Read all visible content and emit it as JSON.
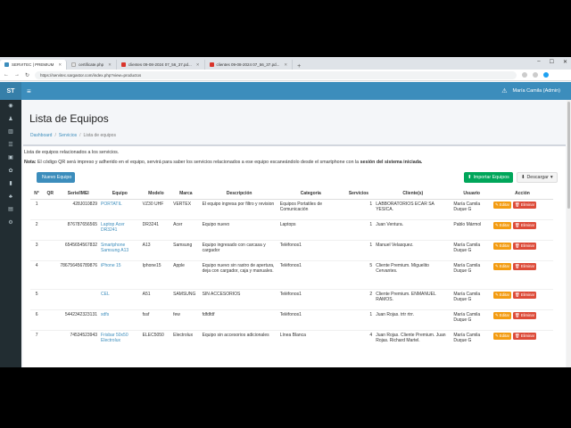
{
  "browser": {
    "tabs": [
      {
        "label": "SERVITEC | PREMIUM",
        "active": true
      },
      {
        "label": "certificate.php",
        "active": false
      },
      {
        "label": "clientes 09-08-2024 07_56_37.pd...",
        "active": false
      },
      {
        "label": "clientes 09-08-2024 07_56_37.pd...",
        "active": false
      }
    ],
    "new_tab": "+",
    "url": "https://servitec.sargastor.com/index.php?view=productos"
  },
  "header": {
    "brand": "ST",
    "user": "María Camila (Admin)"
  },
  "page": {
    "title": "Lista de Equipos",
    "breadcrumb": {
      "home": "Dashboard",
      "services": "Servicios",
      "current": "Lista de equipos",
      "sep": "/"
    },
    "intro": "Lista de equipos relacionados a los servicios.",
    "note_label": "Nota:",
    "note_text": " El código QR será impreso y adherido en el equipo, servirá para saber los servicios relacionados a ese equipo escaneándolo desde el smartphone con la ",
    "note_bold": "sesión del sistema iniciada.",
    "btn_new": "Nuevo Equipo",
    "btn_import": "Importar Equipos",
    "btn_download": "Descargar"
  },
  "table": {
    "headers": [
      "N°",
      "QR",
      "Serie/IMEI",
      "Equipo",
      "Modelo",
      "Marca",
      "Descripción",
      "Categoría",
      "Servicios",
      "Cliente(s)",
      "Usuario",
      "Acción"
    ],
    "edit_label": "Editar",
    "delete_label": "Eliminar",
    "rows": [
      {
        "n": "1",
        "serie": "428J010829",
        "equipo": "PORTATIL",
        "modelo": "VZ30 UHF",
        "marca": "VERTEX",
        "desc": "El equipo ingresa por filtro y revision",
        "cat": "Equipos Portatiles de Comunicación",
        "serv": "1",
        "cliente": "LABBORATORIOS ECAR SA YESICA.",
        "usuario": "María Camila Duque G"
      },
      {
        "n": "2",
        "serie": "876787656565",
        "equipo": "Laptop Acer DR3241",
        "modelo": "DR3241",
        "marca": "Acer",
        "desc": "Equipo nuevo",
        "cat": "Laptops",
        "serv": "1",
        "cliente": "Juan Ventura.",
        "usuario": "Pablo Mármol"
      },
      {
        "n": "3",
        "serie": "6545654567832",
        "equipo": "Smartphone Samsung A13",
        "modelo": "A13",
        "marca": "Samsung",
        "desc": "Equipo ingresado con carcasa y cargador",
        "cat": "Teléfonos1",
        "serv": "1",
        "cliente": "Manuel Velasquez.",
        "usuario": "María Camila Duque G"
      },
      {
        "n": "4",
        "serie": "786756456789876",
        "equipo": "iPhone 15",
        "modelo": "Iphone15",
        "marca": "Apple",
        "desc": "Equipo nuevo sin rastro de apertura, deja con cargador, caja y manuales.",
        "cat": "Teléfonos1",
        "serv": "5",
        "cliente": "Cliente Premium. Miguelito Cervantes.",
        "usuario": "María Camila Duque G"
      },
      {
        "n": "5",
        "serie": "",
        "equipo": "CEL",
        "modelo": "A51",
        "marca": "SAMSUNG",
        "desc": "SIN ACCESORIOS",
        "cat": "Teléfonos1",
        "serv": "2",
        "cliente": "Cliente Premium. ENMANUEL RAMOS.",
        "usuario": "María Camila Duque G"
      },
      {
        "n": "6",
        "serie": "5442342323131",
        "equipo": "sdfs",
        "modelo": "fssf",
        "marca": "few",
        "desc": "fdfdfdf",
        "cat": "Teléfonos1",
        "serv": "1",
        "cliente": "Juan Rojas. trtr rtrr.",
        "usuario": "María Camila Duque G"
      },
      {
        "n": "7",
        "serie": "74534523943",
        "equipo": "Frisbar 50x50 Electrolux",
        "modelo": "ELEC5050",
        "marca": "Electrolux",
        "desc": "Equipo sin accesorios adicionales",
        "cat": "Línea Blanca",
        "serv": "4",
        "cliente": "Juan Rojas. Cliente Premium. Juan Rojas. Richard Martel.",
        "usuario": "María Camila Duque G"
      }
    ]
  }
}
